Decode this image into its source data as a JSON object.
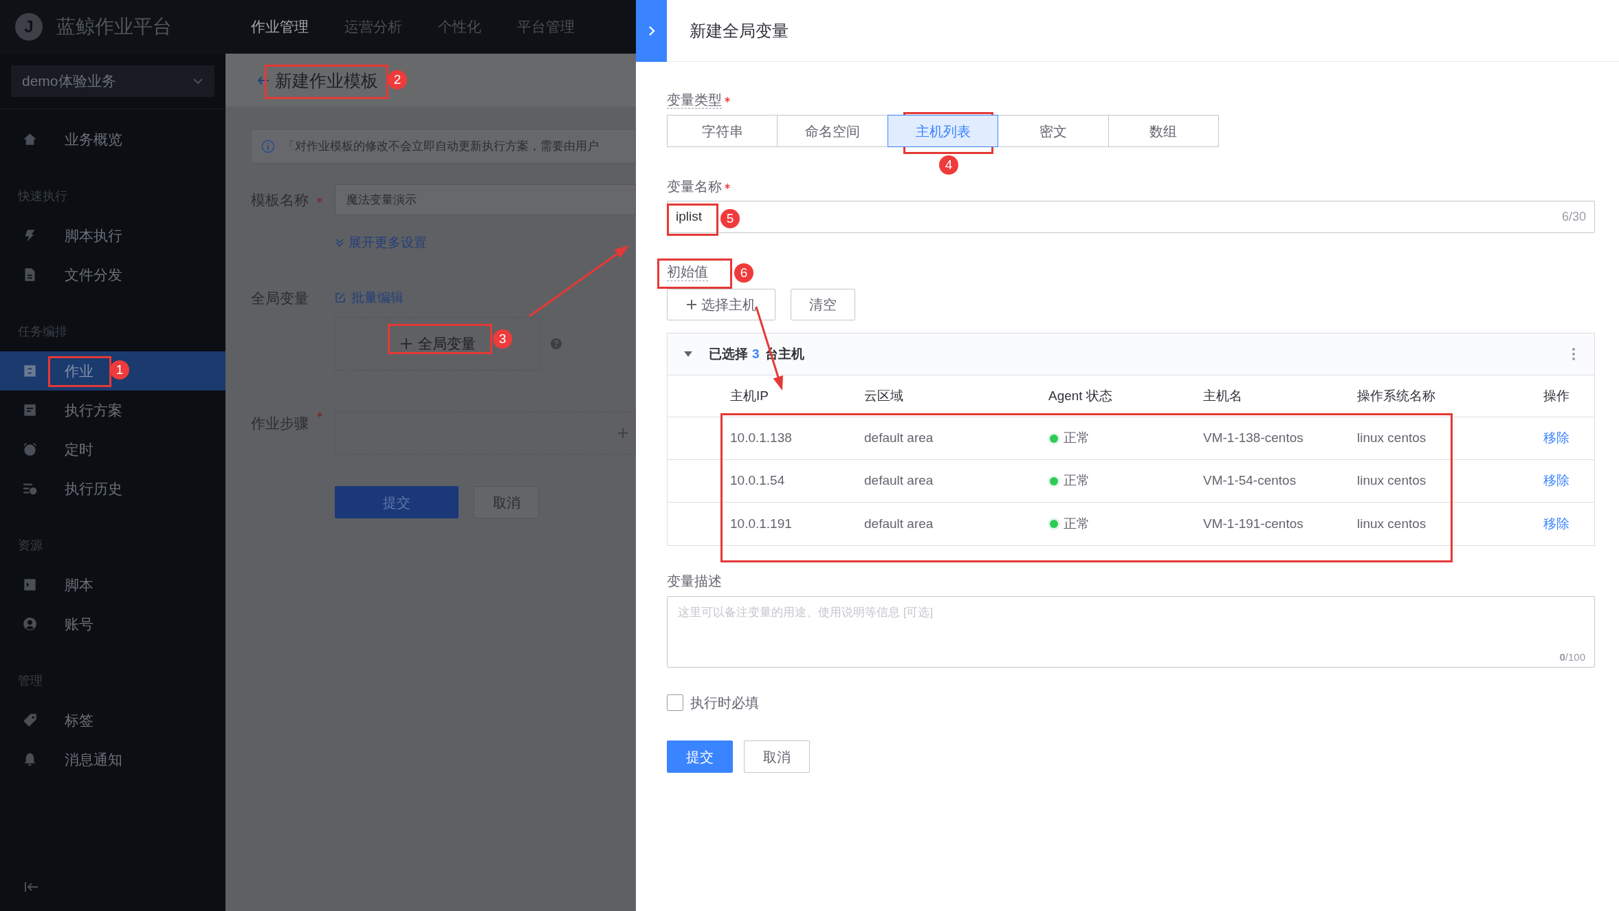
{
  "app": {
    "logo": "J",
    "title": "蓝鲸作业平台",
    "nav": [
      {
        "label": "作业管理",
        "selected": true
      },
      {
        "label": "运营分析",
        "selected": false
      },
      {
        "label": "个性化",
        "selected": false
      },
      {
        "label": "平台管理",
        "selected": false
      }
    ]
  },
  "sidebar": {
    "business": "demo体验业务",
    "sections": [
      {
        "items": [
          {
            "label": "业务概览",
            "selected": false
          }
        ]
      },
      {
        "heading": "快速执行",
        "items": [
          {
            "label": "脚本执行",
            "selected": false
          },
          {
            "label": "文件分发",
            "selected": false
          }
        ]
      },
      {
        "heading": "任务编排",
        "items": [
          {
            "label": "作业",
            "selected": true
          },
          {
            "label": "执行方案",
            "selected": false
          },
          {
            "label": "定时",
            "selected": false
          },
          {
            "label": "执行历史",
            "selected": false
          }
        ]
      },
      {
        "heading": "资源",
        "items": [
          {
            "label": "脚本",
            "selected": false
          },
          {
            "label": "账号",
            "selected": false
          }
        ]
      },
      {
        "heading": "管理",
        "items": [
          {
            "label": "标签",
            "selected": false
          },
          {
            "label": "消息通知",
            "selected": false
          }
        ]
      }
    ]
  },
  "page": {
    "title": "新建作业模板",
    "notice": "「对作业模板的修改不会立即自动更新执行方案，需要由用户",
    "name_label": "模板名称",
    "name_required": true,
    "name_value": "魔法变量演示",
    "expand": "展开更多设置",
    "vars_label": "全局变量",
    "batch_edit": "批量编辑",
    "add_var": "全局变量",
    "steps_label": "作业步骤",
    "steps_required": true,
    "submit": "提交",
    "cancel": "取消"
  },
  "drawer": {
    "title": "新建全局变量",
    "type_label": "变量类型",
    "type_required": true,
    "types": [
      {
        "label": "字符串",
        "selected": false
      },
      {
        "label": "命名空间",
        "selected": false
      },
      {
        "label": "主机列表",
        "selected": true
      },
      {
        "label": "密文",
        "selected": false
      },
      {
        "label": "数组",
        "selected": false
      }
    ],
    "name_label": "变量名称",
    "name_required": true,
    "name_value": "iplist",
    "name_counter": "6/30",
    "initial_label": "初始值",
    "select_hosts": "选择主机",
    "clear": "清空",
    "hosts": {
      "expanded": true,
      "prefix": "已选择",
      "count": "3",
      "suffix": "台主机",
      "columns": [
        "主机IP",
        "云区域",
        "Agent 状态",
        "主机名",
        "操作系统名称",
        "操作"
      ],
      "rows": [
        {
          "ip": "10.0.1.138",
          "area": "default area",
          "status": "正常",
          "color": "#2dcb56",
          "hostname": "VM-1-138-centos",
          "os": "linux centos",
          "action": "移除"
        },
        {
          "ip": "10.0.1.54",
          "area": "default area",
          "status": "正常",
          "color": "#2dcb56",
          "hostname": "VM-1-54-centos",
          "os": "linux centos",
          "action": "移除"
        },
        {
          "ip": "10.0.1.191",
          "area": "default area",
          "status": "正常",
          "color": "#2dcb56",
          "hostname": "VM-1-191-centos",
          "os": "linux centos",
          "action": "移除"
        }
      ]
    },
    "desc_label": "变量描述",
    "desc_placeholder": "这里可以备注变量的用途、使用说明等信息 [可选]",
    "desc_counter": "**0**/100",
    "required_label": "执行时必填",
    "required_checked": false,
    "submit": "提交",
    "cancel": "取消"
  },
  "annotations": [
    {
      "kind": "numbered",
      "number": "1"
    },
    {
      "kind": "numbered",
      "number": "2"
    },
    {
      "kind": "numbered",
      "number": "3"
    },
    {
      "kind": "numbered",
      "number": "4"
    },
    {
      "kind": "numbered",
      "number": "5"
    },
    {
      "kind": "numbered",
      "number": "6"
    },
    {
      "kind": "box"
    },
    {
      "kind": "arrow"
    },
    {
      "kind": "arrow"
    }
  ]
}
